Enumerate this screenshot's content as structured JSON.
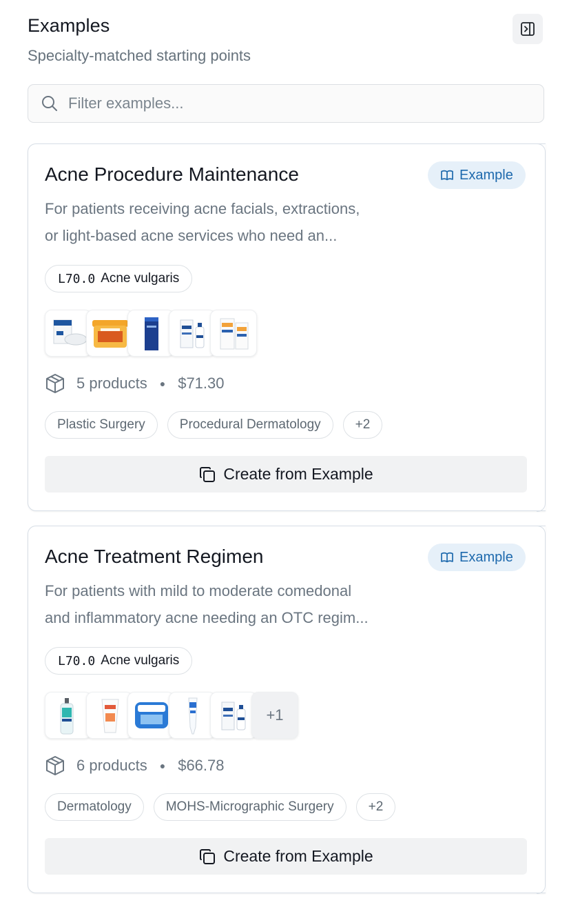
{
  "header": {
    "title": "Examples",
    "subtitle": "Specialty-matched starting points",
    "collapse_icon": "panel-collapse-icon"
  },
  "search": {
    "placeholder": "Filter examples...",
    "value": "",
    "icon": "search-icon"
  },
  "cards": [
    {
      "title": "Acne Procedure Maintenance",
      "badge": "Example",
      "description_line1": "For patients receiving acne facials, extractions,",
      "description_line2": "or light-based acne services who need an...",
      "diagnosis_code": "L70.0",
      "diagnosis_name": "Acne vulgaris",
      "product_thumbnails": [
        "benzoyl-wash-tube",
        "salicylic-pads-jar",
        "blue-serum-box",
        "cerave-lotion-bottles",
        "sunscreen-tubes"
      ],
      "products_label": "5 products",
      "price": "$71.30",
      "tags": [
        "Plastic Surgery",
        "Procedural Dermatology",
        "+2"
      ],
      "button_label": "Create from Example"
    },
    {
      "title": "Acne Treatment Regimen",
      "badge": "Example",
      "description_line1": "For patients with mild to moderate comedonal",
      "description_line2": "and inflammatory acne needing an OTC regim...",
      "diagnosis_code": "L70.0",
      "diagnosis_name": "Acne vulgaris",
      "product_thumbnails": [
        "cerave-cleanser-pump",
        "clean-clear-tube",
        "clean-clear-pads",
        "blue-spot-tube",
        "cerave-lotion-bottles"
      ],
      "more_products": "+1",
      "products_label": "6 products",
      "price": "$66.78",
      "tags": [
        "Dermatology",
        "MOHS-Micrographic Surgery",
        "+2"
      ],
      "button_label": "Create from Example"
    }
  ],
  "colors": {
    "badge_bg": "#e6f0f9",
    "badge_text": "#1d69ad",
    "muted_text": "#6a7580",
    "card_border": "#d7dee6",
    "button_bg": "#f1f2f3"
  }
}
